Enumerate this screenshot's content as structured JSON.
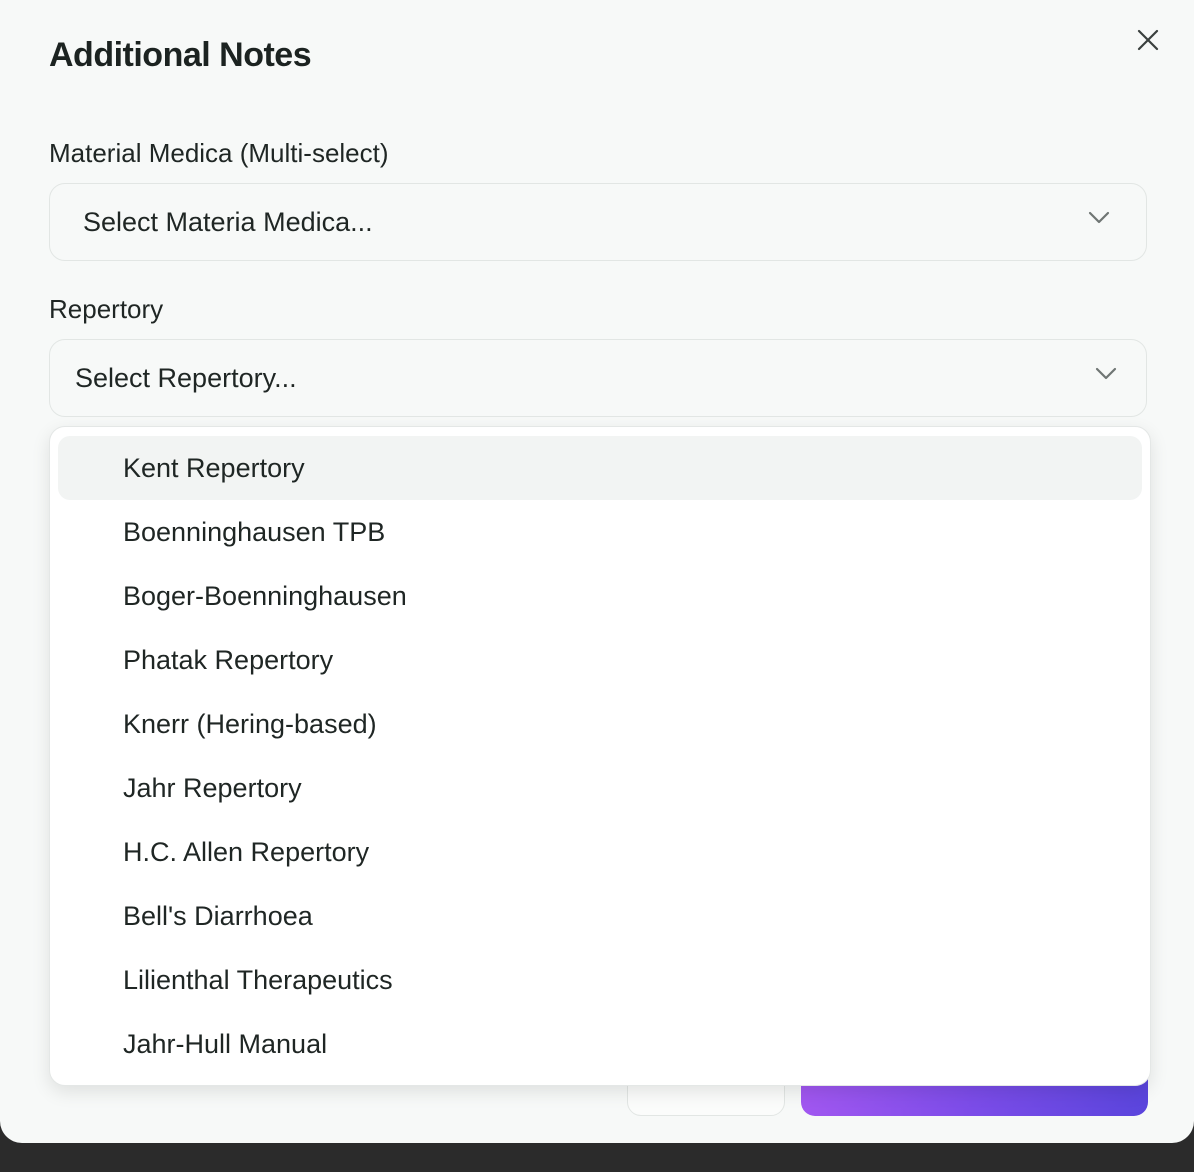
{
  "modal": {
    "title": "Additional Notes"
  },
  "materia_medica": {
    "label": "Material Medica (Multi-select)",
    "placeholder": "Select Materia Medica..."
  },
  "repertory": {
    "label": "Repertory",
    "placeholder": "Select Repertory...",
    "options": [
      "Kent Repertory",
      "Boenninghausen TPB",
      "Boger-Boenninghausen",
      "Phatak Repertory",
      "Knerr (Hering-based)",
      "Jahr Repertory",
      "H.C. Allen Repertory",
      "Bell's Diarrhoea",
      "Lilienthal Therapeutics",
      "Jahr-Hull Manual"
    ],
    "highlighted_index": 0
  },
  "colors": {
    "modal_bg": "#f7f9f8",
    "primary_gradient_start": "#a157f0",
    "primary_gradient_end": "#5a45dc",
    "option_highlight": "#f2f4f3"
  },
  "icons": {
    "close": "close-icon",
    "chevron": "chevron-down-icon"
  }
}
